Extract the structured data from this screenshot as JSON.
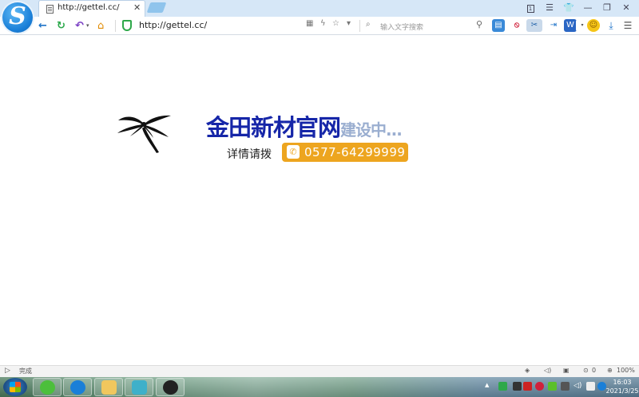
{
  "browser": {
    "logo_letter": "S",
    "tab": {
      "title": "http://gettel.cc/",
      "close": "✕"
    },
    "window_controls": [
      "1",
      "☰",
      "👕",
      "—",
      "❐",
      "✕"
    ],
    "address": "http://gettel.cc/",
    "search_placeholder": "输入文字搜索"
  },
  "page": {
    "brand_main": "金田新材官网",
    "brand_sub": "建设中...",
    "contact_label": "详情请拨",
    "phone_icon": "✆",
    "phone": "0577-64299999"
  },
  "statusbar": {
    "left": "完成",
    "zoom": "100%",
    "download_count": "0"
  },
  "taskbar": {
    "time": "16:03",
    "date": "2021/3/25"
  },
  "colors": {
    "brand_blue": "#1626a8",
    "sub_blue": "#9aaed0",
    "phone_orange": "#eda51f"
  }
}
